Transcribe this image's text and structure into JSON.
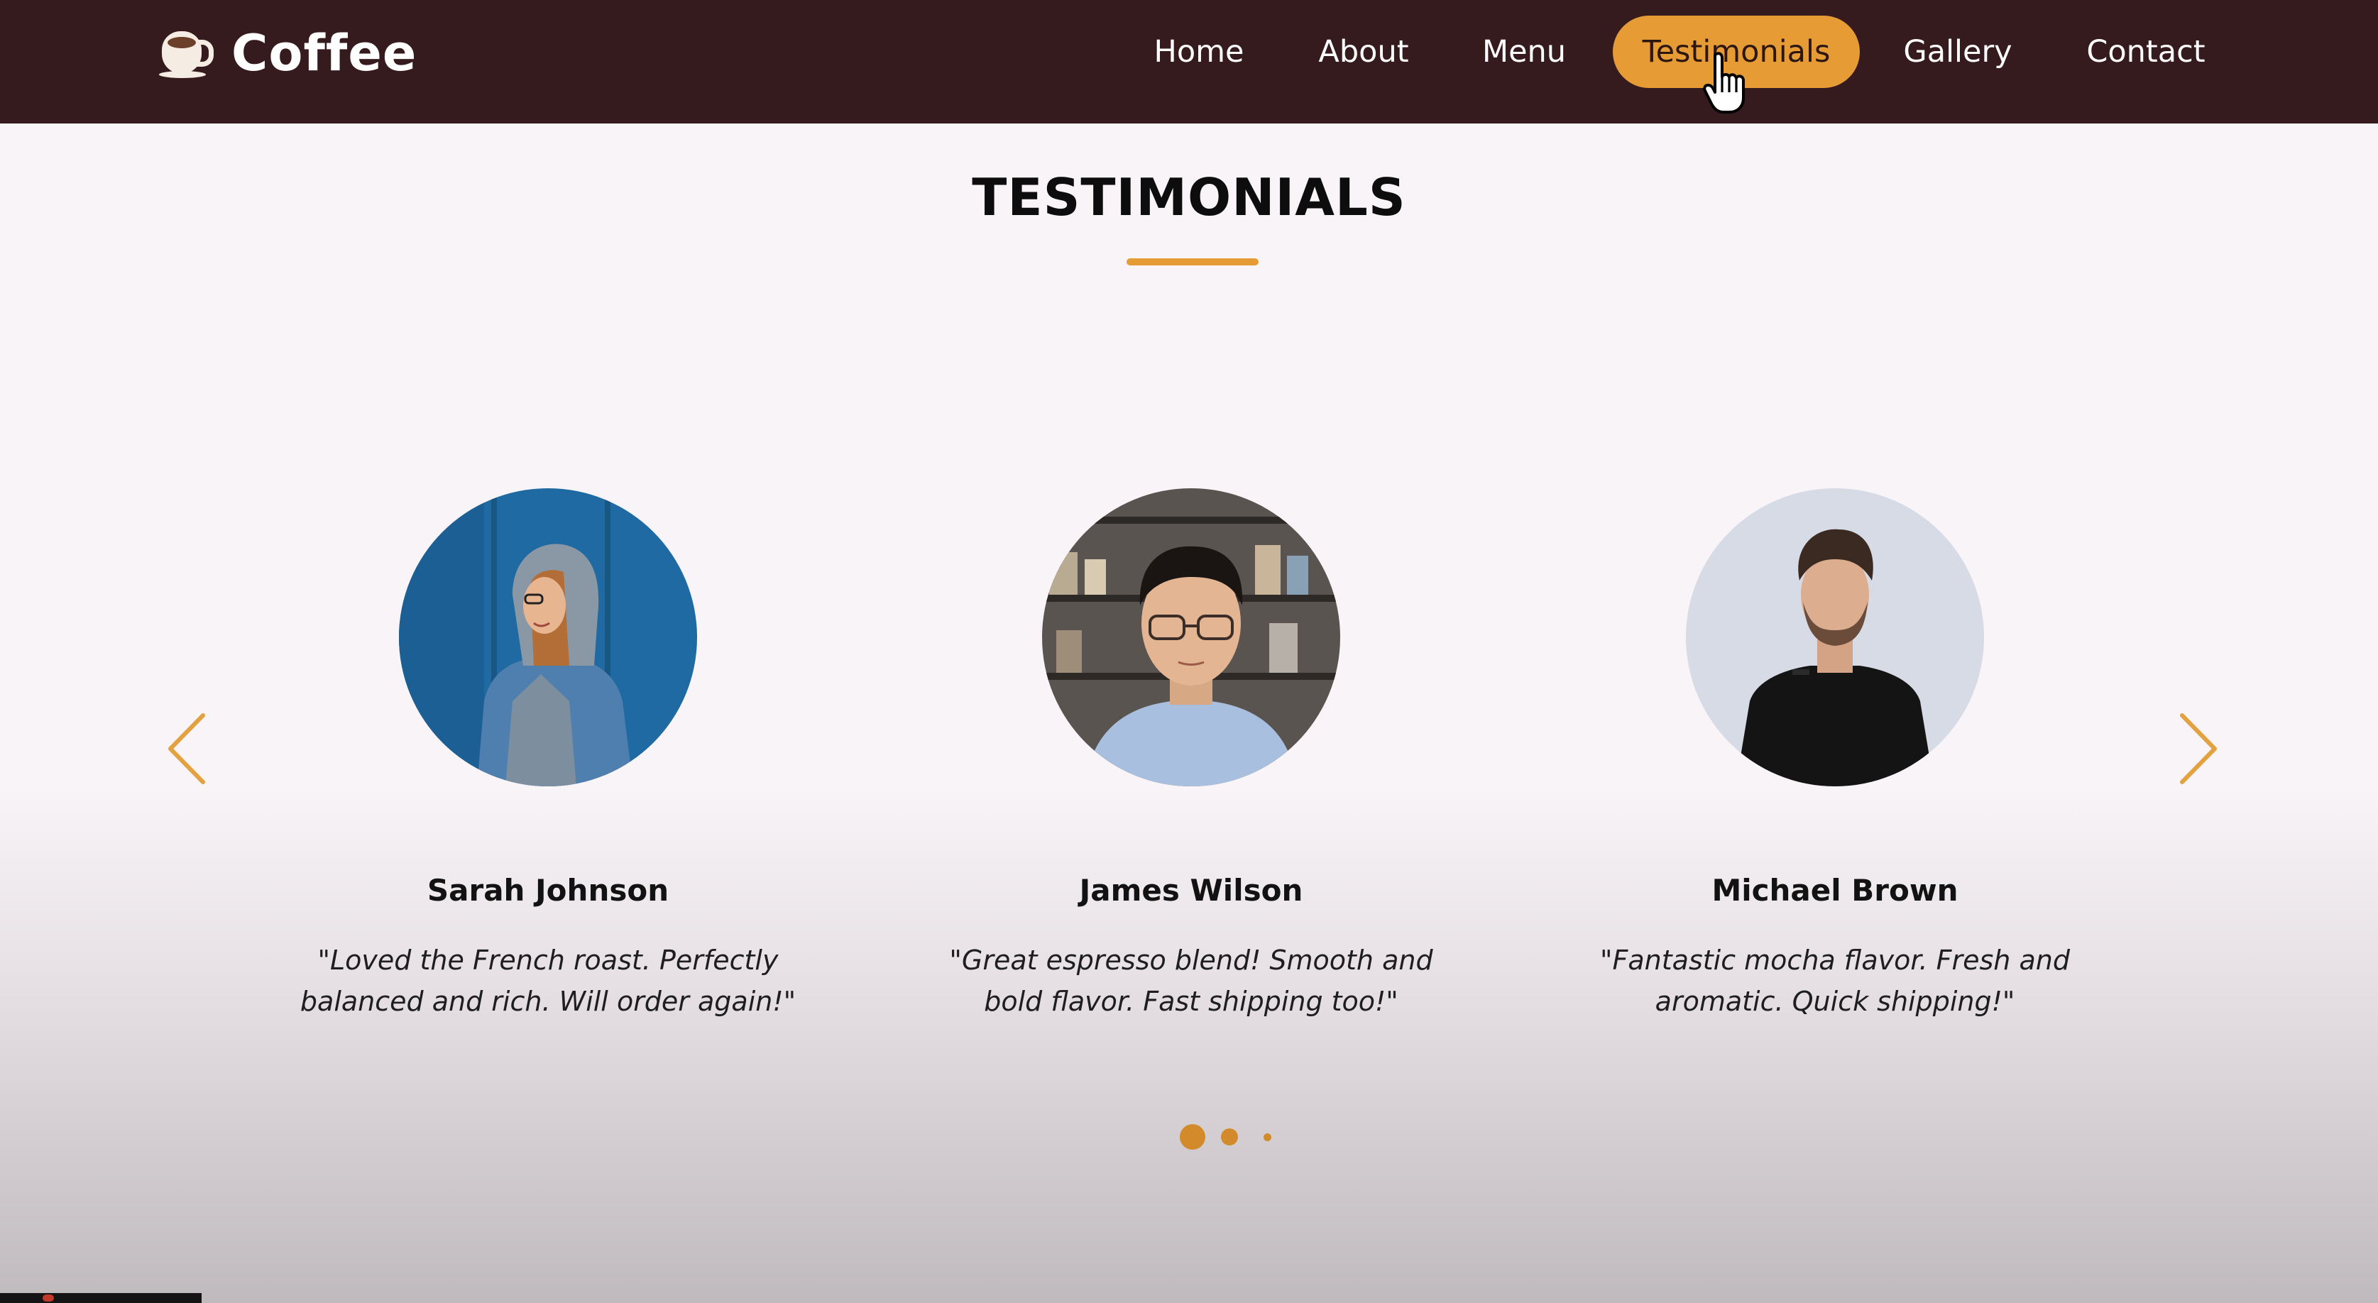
{
  "brand": {
    "name": "Coffee",
    "icon": "coffee-cup-icon"
  },
  "nav": {
    "items": [
      {
        "label": "Home"
      },
      {
        "label": "About"
      },
      {
        "label": "Menu"
      },
      {
        "label": "Testimonials",
        "active": true
      },
      {
        "label": "Gallery"
      },
      {
        "label": "Contact"
      }
    ]
  },
  "section": {
    "title": "TESTIMONIALS"
  },
  "testimonials": [
    {
      "name": "Sarah Johnson",
      "quote_line1": "\"Loved the French roast. Perfectly",
      "quote_line2": "balanced and rich. Will order again!\""
    },
    {
      "name": "James Wilson",
      "quote_line1": "\"Great espresso blend! Smooth and",
      "quote_line2": "bold flavor. Fast shipping too!\""
    },
    {
      "name": "Michael Brown",
      "quote_line1": "\"Fantastic mocha flavor. Fresh and",
      "quote_line2": "aromatic. Quick shipping!\""
    }
  ],
  "carousel": {
    "prev_icon": "chevron-left-icon",
    "next_icon": "chevron-right-icon",
    "dots": 3,
    "active_dot": 1
  },
  "colors": {
    "nav_bg": "#351a1e",
    "accent": "#e79b35",
    "page_bg": "#f8f4f7"
  }
}
